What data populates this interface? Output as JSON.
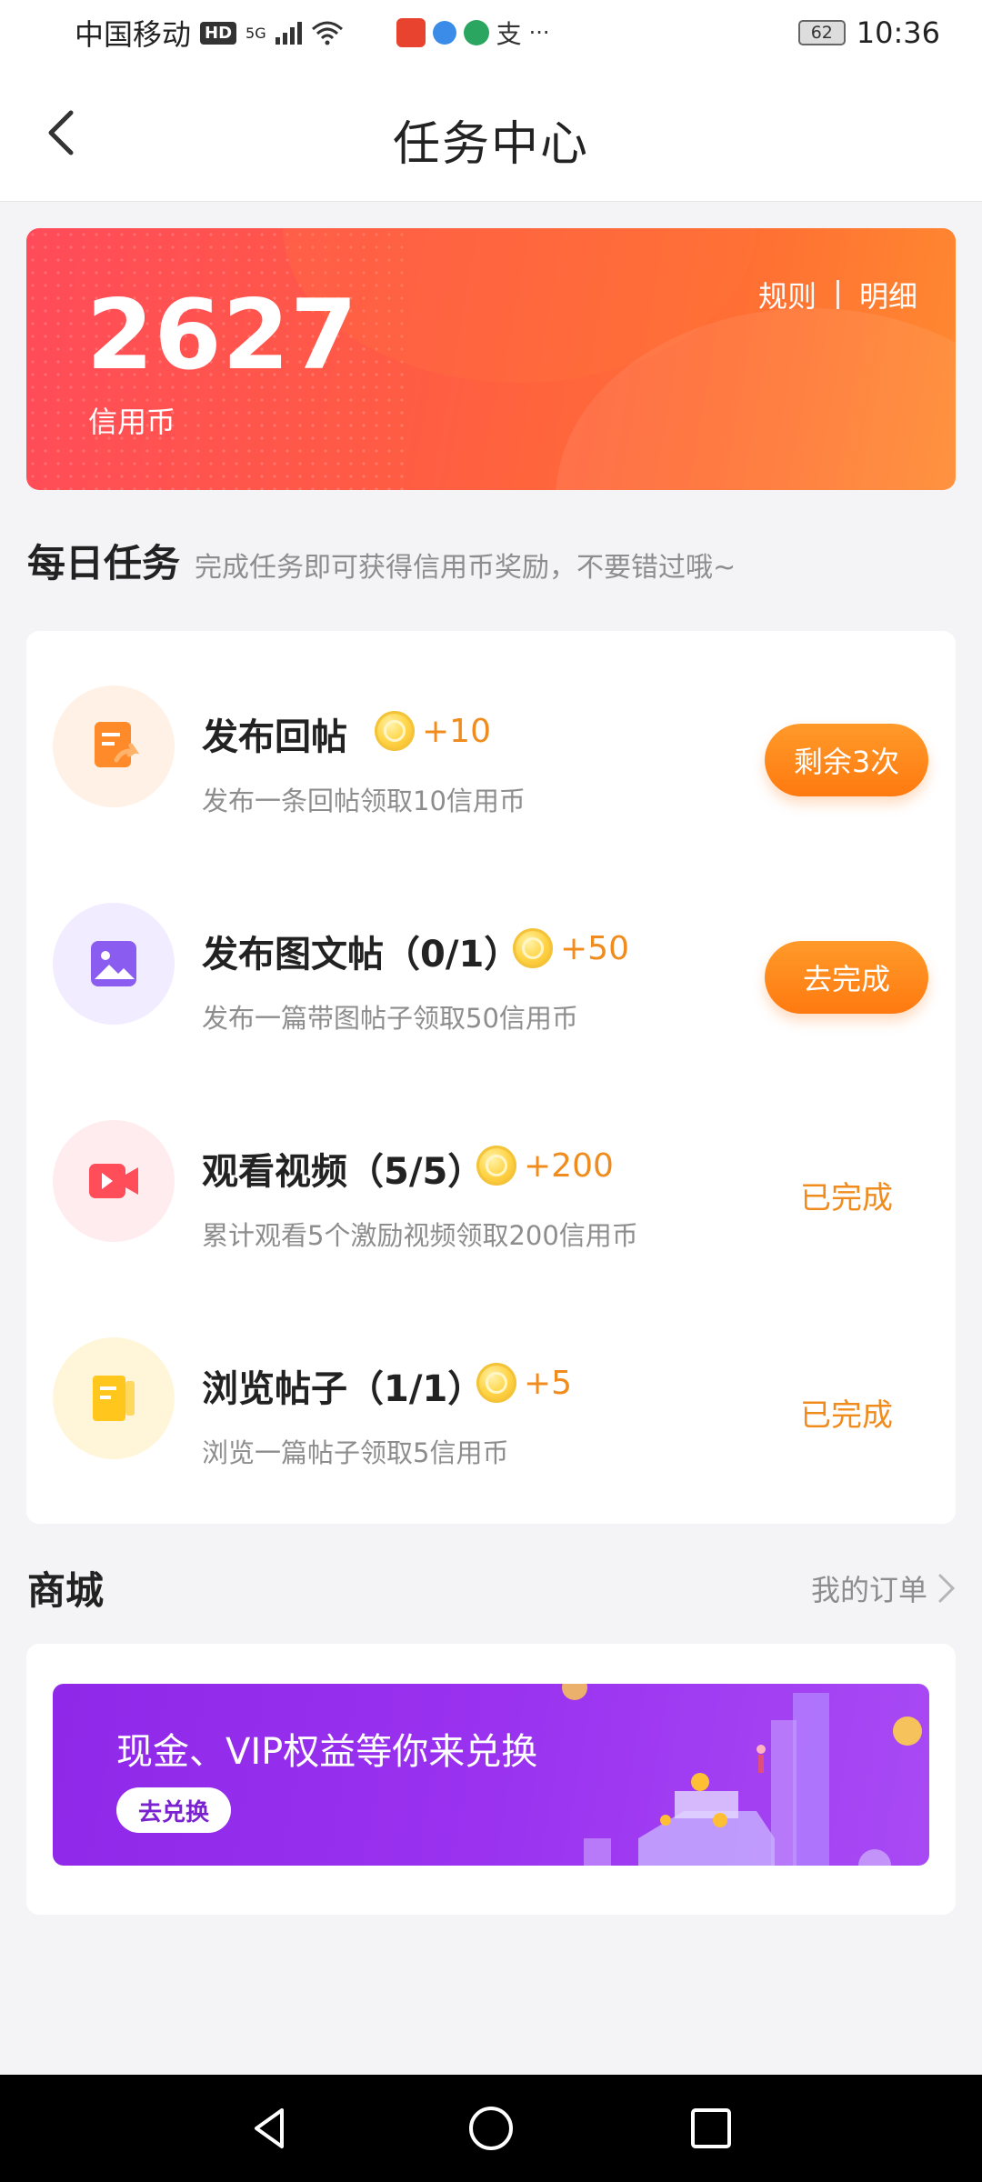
{
  "status_bar": {
    "carrier": "中国移动",
    "hd": "HD",
    "network": "5G",
    "battery": "62",
    "time": "10:36"
  },
  "header": {
    "title": "任务中心"
  },
  "credit": {
    "value": "2627",
    "unit": "信用币",
    "rules_label": "规则",
    "details_label": "明细"
  },
  "daily": {
    "title": "每日任务",
    "subtitle": "完成任务即可获得信用币奖励，不要错过哦~",
    "tasks": [
      {
        "name": "发布回帖",
        "reward": "+10",
        "desc": "发布一条回帖领取10信用币",
        "action": "剩余3次",
        "status": "button",
        "icon": "reply-post-icon",
        "color": "#ff8a2a"
      },
      {
        "name": "发布图文帖（0/1）",
        "reward": "+50",
        "desc": "发布一篇带图帖子领取50信用币",
        "action": "去完成",
        "status": "button",
        "icon": "image-post-icon",
        "color": "#8a5cf0"
      },
      {
        "name": "观看视频（5/5）",
        "reward": "+200",
        "desc": "累计观看5个激励视频领取200信用币",
        "action": "已完成",
        "status": "done",
        "icon": "video-icon",
        "color": "#ff4d5a"
      },
      {
        "name": "浏览帖子（1/1）",
        "reward": "+5",
        "desc": "浏览一篇帖子领取5信用币",
        "action": "已完成",
        "status": "done",
        "icon": "browse-post-icon",
        "color": "#ffc61e"
      }
    ]
  },
  "mall": {
    "title": "商城",
    "orders_label": "我的订单",
    "banner_text": "现金、VIP权益等你来兑换",
    "banner_button": "去兑换"
  },
  "colors": {
    "accent_orange": "#f08c1e",
    "credit_gradient_start": "#ff4b5a",
    "credit_gradient_end": "#ff8a30",
    "promo_purple": "#9a32f0"
  }
}
